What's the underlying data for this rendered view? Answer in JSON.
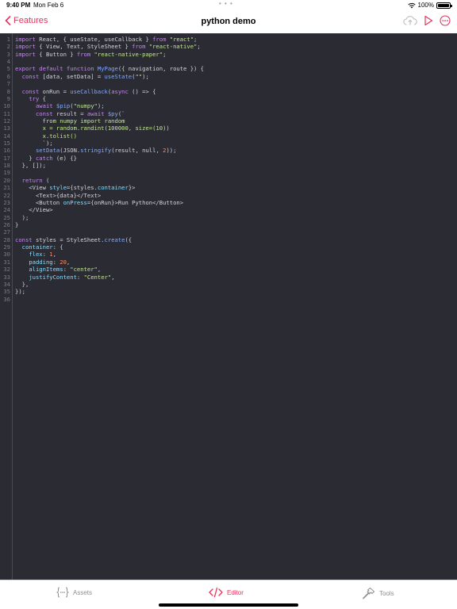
{
  "status_bar": {
    "time": "9:40 PM",
    "date": "Mon Feb 6",
    "battery": "100%"
  },
  "nav": {
    "back_label": "Features",
    "title": "python demo",
    "accent_color": "#e8315b",
    "actions": [
      "cloud-upload-icon",
      "play-icon",
      "more-icon"
    ]
  },
  "editor": {
    "background": "#2b2b33",
    "lines": [
      [
        [
          "kw",
          "import"
        ],
        [
          "pl",
          " React, { useState, useCallback } "
        ],
        [
          "kw",
          "from"
        ],
        [
          "str",
          " \"react\""
        ],
        [
          "pl",
          ";"
        ]
      ],
      [
        [
          "kw",
          "import"
        ],
        [
          "pl",
          " { View, Text, StyleSheet } "
        ],
        [
          "kw",
          "from"
        ],
        [
          "str",
          " \"react-native\""
        ],
        [
          "pl",
          ";"
        ]
      ],
      [
        [
          "kw",
          "import"
        ],
        [
          "pl",
          " { Button } "
        ],
        [
          "kw",
          "from"
        ],
        [
          "str",
          " \"react-native-paper\""
        ],
        [
          "pl",
          ";"
        ]
      ],
      [],
      [
        [
          "kw",
          "export default function"
        ],
        [
          "fn",
          " MyPage"
        ],
        [
          "pl",
          "({ navigation, route }) {"
        ]
      ],
      [
        [
          "pl",
          "  "
        ],
        [
          "kw",
          "const"
        ],
        [
          "pl",
          " [data, setData] = "
        ],
        [
          "fn",
          "useState"
        ],
        [
          "pl",
          "("
        ],
        [
          "str",
          "\"\""
        ],
        [
          "pl",
          ");"
        ]
      ],
      [],
      [
        [
          "pl",
          "  "
        ],
        [
          "kw",
          "const"
        ],
        [
          "pl",
          " onRun = "
        ],
        [
          "fn",
          "useCallback"
        ],
        [
          "pl",
          "("
        ],
        [
          "kw",
          "async"
        ],
        [
          "pl",
          " () => {"
        ]
      ],
      [
        [
          "pl",
          "    "
        ],
        [
          "kw",
          "try"
        ],
        [
          "pl",
          " {"
        ]
      ],
      [
        [
          "pl",
          "      "
        ],
        [
          "kw",
          "await"
        ],
        [
          "fn",
          " $pip"
        ],
        [
          "pl",
          "("
        ],
        [
          "str",
          "\"numpy\""
        ],
        [
          "pl",
          ");"
        ]
      ],
      [
        [
          "pl",
          "      "
        ],
        [
          "kw",
          "const"
        ],
        [
          "pl",
          " result = "
        ],
        [
          "kw",
          "await"
        ],
        [
          "fn",
          " $py"
        ],
        [
          "pl",
          "(`"
        ]
      ],
      [
        [
          "str",
          "        from numpy import random"
        ]
      ],
      [
        [
          "str",
          "        x = random.randint(100000, size=(10))"
        ]
      ],
      [
        [
          "str",
          "        x.tolist()"
        ]
      ],
      [
        [
          "str",
          "        `"
        ],
        [
          "pl",
          ");"
        ]
      ],
      [
        [
          "pl",
          "      "
        ],
        [
          "fn",
          "setData"
        ],
        [
          "pl",
          "(JSON."
        ],
        [
          "fn",
          "stringify"
        ],
        [
          "pl",
          "(result, null, "
        ],
        [
          "num",
          "2"
        ],
        [
          "pl",
          "));"
        ]
      ],
      [
        [
          "pl",
          "    } "
        ],
        [
          "kw",
          "catch"
        ],
        [
          "pl",
          " (e) {}"
        ]
      ],
      [
        [
          "pl",
          "  }, []);"
        ]
      ],
      [],
      [
        [
          "pl",
          "  "
        ],
        [
          "kw",
          "return"
        ],
        [
          "pl",
          " ("
        ]
      ],
      [
        [
          "pl",
          "    <View "
        ],
        [
          "at",
          "style"
        ],
        [
          "pl",
          "={styles."
        ],
        [
          "at",
          "container"
        ],
        [
          "pl",
          "}>"
        ]
      ],
      [
        [
          "pl",
          "      <Text>{data}</Text>"
        ]
      ],
      [
        [
          "pl",
          "      <Button "
        ],
        [
          "at",
          "onPress"
        ],
        [
          "pl",
          "={onRun}>Run Python</Button>"
        ]
      ],
      [
        [
          "pl",
          "    </View>"
        ]
      ],
      [
        [
          "pl",
          "  );"
        ]
      ],
      [
        [
          "pl",
          "}"
        ]
      ],
      [],
      [
        [
          "kw",
          "const"
        ],
        [
          "pl",
          " styles = StyleSheet."
        ],
        [
          "fn",
          "create"
        ],
        [
          "pl",
          "({"
        ]
      ],
      [
        [
          "pl",
          "  "
        ],
        [
          "at",
          "container"
        ],
        [
          "pl",
          ": {"
        ]
      ],
      [
        [
          "pl",
          "    "
        ],
        [
          "at",
          "flex"
        ],
        [
          "pl",
          ": "
        ],
        [
          "num",
          "1"
        ],
        [
          "pl",
          ","
        ]
      ],
      [
        [
          "pl",
          "    "
        ],
        [
          "at",
          "padding"
        ],
        [
          "pl",
          ": "
        ],
        [
          "num",
          "20"
        ],
        [
          "pl",
          ","
        ]
      ],
      [
        [
          "pl",
          "    "
        ],
        [
          "at",
          "alignItems"
        ],
        [
          "pl",
          ": "
        ],
        [
          "str",
          "\"center\""
        ],
        [
          "pl",
          ","
        ]
      ],
      [
        [
          "pl",
          "    "
        ],
        [
          "at",
          "justifyContent"
        ],
        [
          "pl",
          ": "
        ],
        [
          "str",
          "\"Center\""
        ],
        [
          "pl",
          ","
        ]
      ],
      [
        [
          "pl",
          "  },"
        ]
      ],
      [
        [
          "pl",
          "});"
        ]
      ],
      []
    ]
  },
  "tab_bar": {
    "tabs": [
      {
        "label": "Assets",
        "icon": "braces-icon",
        "active": false
      },
      {
        "label": "Editor",
        "icon": "code-icon",
        "active": true
      },
      {
        "label": "Tools",
        "icon": "hammer-icon",
        "active": false
      }
    ]
  }
}
